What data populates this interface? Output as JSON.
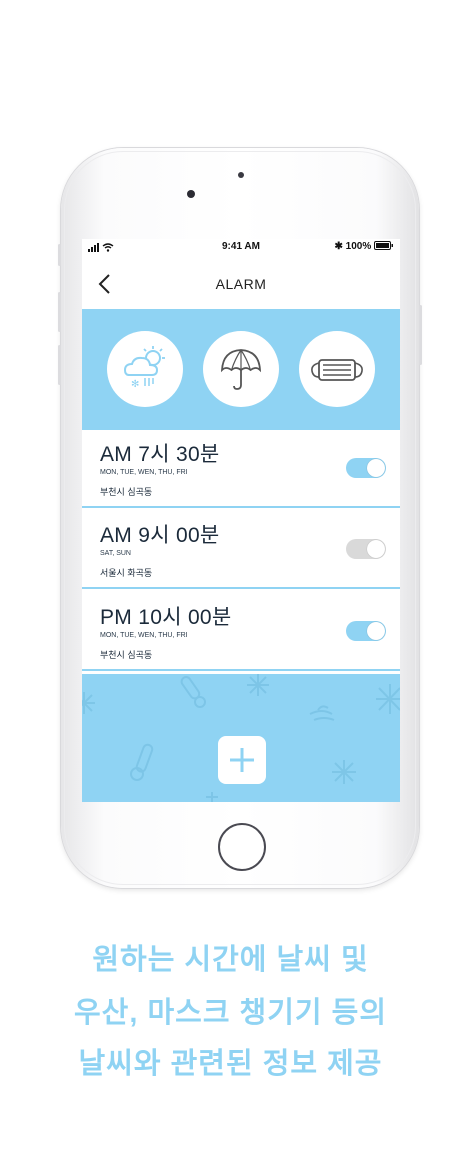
{
  "status_bar": {
    "time": "9:41 AM",
    "battery": "100%"
  },
  "header": {
    "title": "ALARM"
  },
  "weather_icons": [
    "weather-cloud-sun-snow-icon",
    "umbrella-icon",
    "mask-icon"
  ],
  "alarms": [
    {
      "time": "AM  7시 30분",
      "days": "MON, TUE, WEN, THU, FRI",
      "location": "부천시 심곡동",
      "enabled": true
    },
    {
      "time": "AM  9시 00분",
      "days": "SAT, SUN",
      "location": "서울시 화곡동",
      "enabled": false
    },
    {
      "time": "PM  10시 00분",
      "days": "MON, TUE, WEN, THU, FRI",
      "location": "부천시 심곡동",
      "enabled": true
    }
  ],
  "add_button": {
    "icon": "plus-icon"
  },
  "caption": {
    "line1": "원하는 시간에 날씨 및",
    "line2": "우산, 마스크 챙기기 등의",
    "line3": "날씨와 관련된 정보 제공"
  },
  "colors": {
    "accent": "#8fd3f3",
    "toggle_on": "#8fd3f3",
    "toggle_off": "#d9d9d9",
    "text_dark": "#1b2a3a"
  }
}
